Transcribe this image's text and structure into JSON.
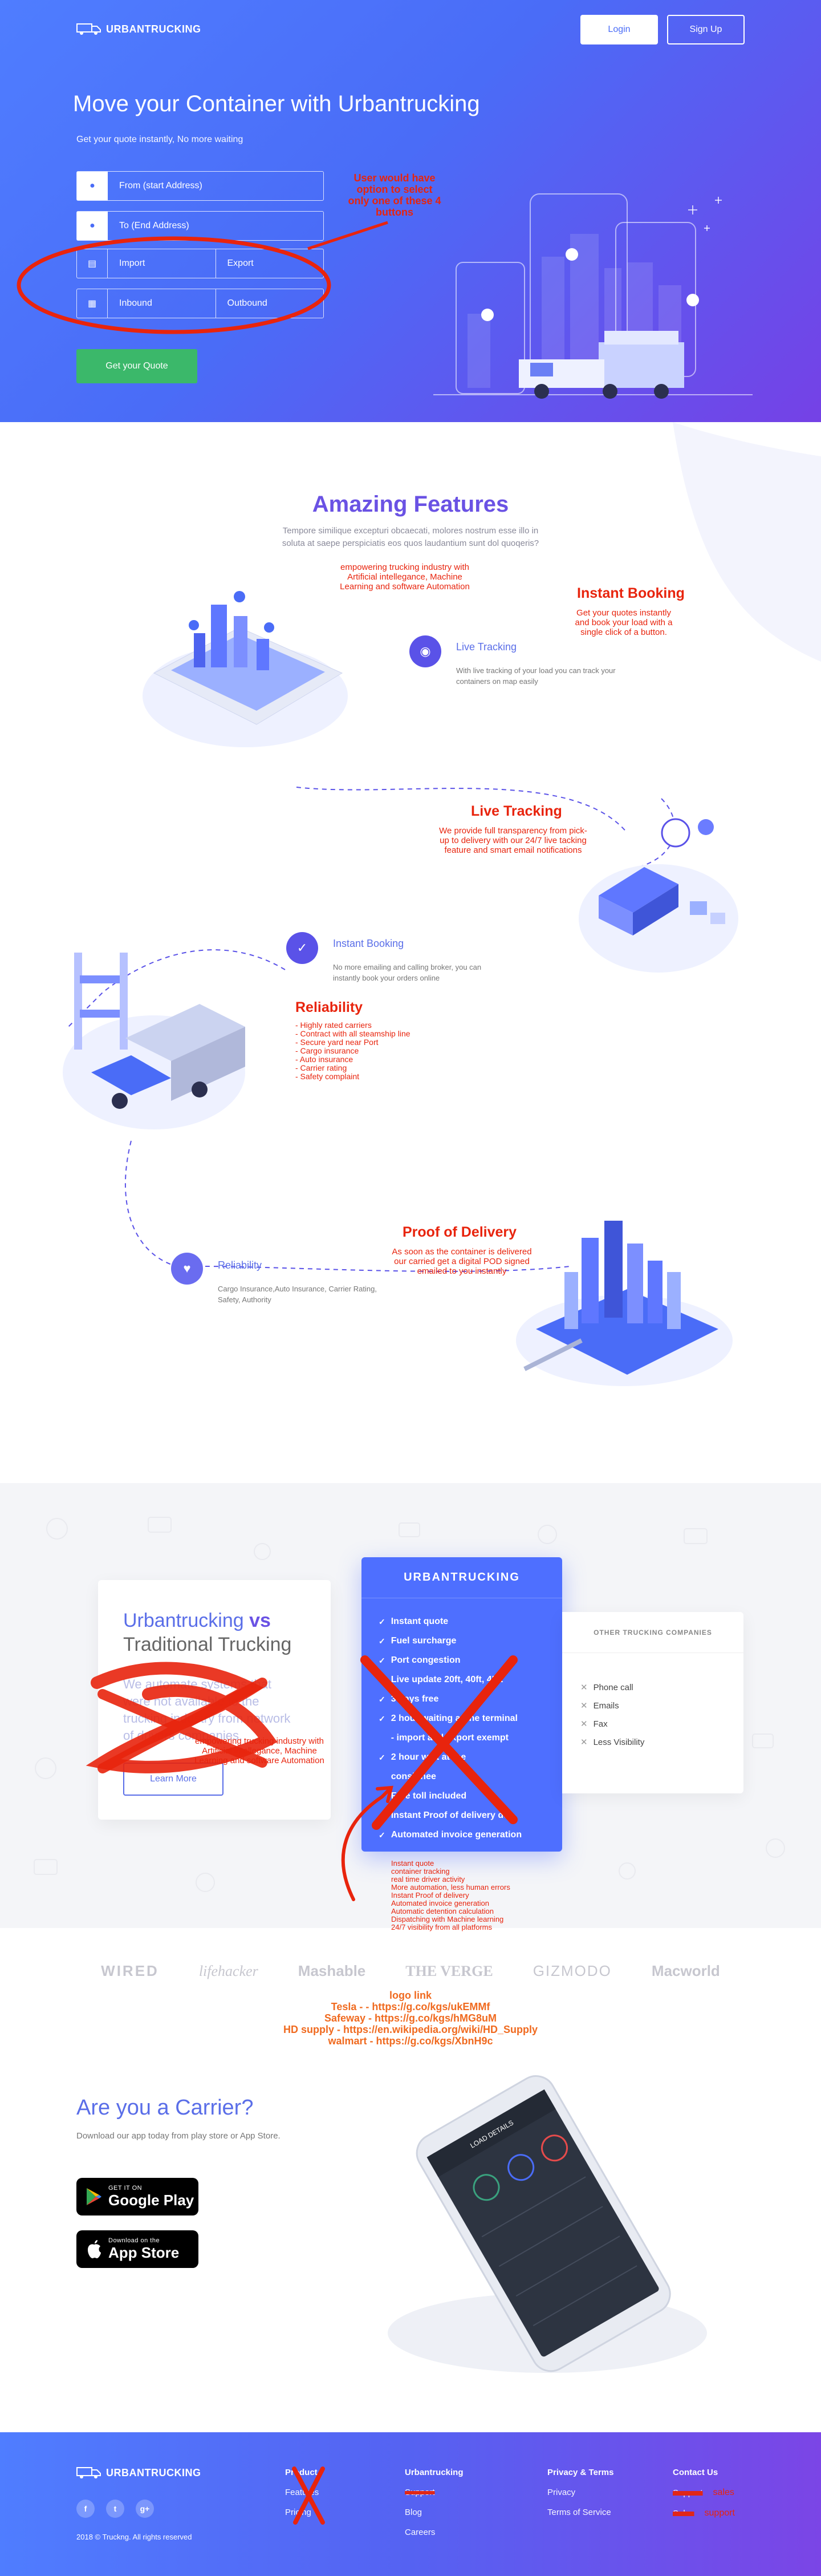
{
  "colors": {
    "brand_blue": "#4a6cf7",
    "brand_purple": "#7541e6",
    "green": "#3bb86a",
    "annotation_red": "#e8240d",
    "annotation_orange": "#f06a1f"
  },
  "header": {
    "logo_text": "URBANTRUCKING",
    "login": "Login",
    "signup": "Sign Up"
  },
  "hero": {
    "title": "Move your Container with Urbantrucking",
    "subtitle": "Get your quote instantly, No more waiting",
    "from_placeholder": "From (start Address)",
    "to_placeholder": "To (End Address)",
    "import": "Import",
    "export": "Export",
    "inbound": "Inbound",
    "outbound": "Outbound",
    "cta": "Get your Quote",
    "note": "User would have option to select only one of these 4 buttons"
  },
  "features": {
    "title": "Amazing Features",
    "subtitle": "Tempore similique excepturi obcaecati, molores nostrum esse illo in soluta at saepe perspiciatis eos quos laudantium sunt dol quoqeris?",
    "note_ai": "empowering trucking industry with Artificial intellegance, Machine Learning and software Automation",
    "instant_booking_note": {
      "title": "Instant Booking",
      "text": "Get your quotes instantly and book your load with a single click of a button."
    },
    "live_tracking": {
      "label": "Live Tracking",
      "desc": "With live tracking of your load you can track your containers on map easily"
    },
    "live_tracking_note": {
      "title": "Live Tracking",
      "text": "We provide full transparency from pick-up to delivery with our 24/7 live tacking feature and smart email notifications"
    },
    "instant_booking": {
      "label": "Instant Booking",
      "desc": "No more emailing and calling broker, you can instantly book your orders online"
    },
    "reliability_note": {
      "title": "Reliability",
      "items": [
        "- Highly rated carriers",
        "- Contract with all steamship line",
        "- Secure yard near Port",
        "- Cargo insurance",
        "- Auto insurance",
        "- Carrier rating",
        "- Safety complaint"
      ]
    },
    "reliability": {
      "label": "Reliability",
      "desc": "Cargo Insurance,Auto Insurance, Carrier Rating, Safety, Authority"
    },
    "pod_note": {
      "title": "Proof of Delivery",
      "text": "As soon as the container is delivered our carried get a digital POD signed emailed to you instantly"
    }
  },
  "compare": {
    "title_a": "Urbantrucking ",
    "title_vs": "vs",
    "title_b": "Traditional Trucking",
    "left_text": "We automate systems that were not available to the trucking industry from network of drivers companies.",
    "left_button": "Learn More",
    "mid_heading": "URBANTRUCKING",
    "mid_items": [
      "Instant quote",
      "Fuel surcharge",
      "Port congestion",
      "Live update 20ft, 40ft, 45ft",
      "3 days free",
      "2 hour waiting at the terminal",
      "- import and export exempt",
      "2 hour wait at the",
      "consignee",
      "Free toll included",
      "Instant Proof of delivery doc",
      "Automated invoice generation"
    ],
    "right_heading": "OTHER TRUCKING COMPANIES",
    "right_items": [
      "Phone call",
      "Emails",
      "Fax",
      "Less Visibility"
    ],
    "note_ai": "empowering trucking industry with Artificial intellegance, Machine Learning and software Automation",
    "note_list": [
      "Instant quote",
      "container tracking",
      "real time driver activity",
      "More automation, less human errors",
      "Instant Proof of delivery",
      "Automated invoice generation",
      "Automatic detention calculation",
      "Dispatching with Machine learning",
      "24/7 visibility from all platforms"
    ]
  },
  "press": {
    "logos": [
      "WIRED",
      "lifehacker",
      "Mashable",
      "THE VERGE",
      "GIZMODO",
      "Macworld"
    ],
    "note_title": "logo link",
    "note_lines": [
      "Tesla  -  - https://g.co/kgs/ukEMMf",
      "Safeway - https://g.co/kgs/hMG8uM",
      "HD supply - https://en.wikipedia.org/wiki/HD_Supply",
      "walmart - https://g.co/kgs/XbnH9c"
    ]
  },
  "carrier": {
    "title": "Are you a Carrier?",
    "subtitle": "Download our app today from play store or App Store.",
    "google_small": "GET IT ON",
    "google_big": "Google Play",
    "apple_small": "Download on the",
    "apple_big": "App Store",
    "phone_header": "LOAD DETAILS"
  },
  "footer": {
    "logo_text": "URBANTRUCKING",
    "copyright": "2018 © Truckng. All rights reserved",
    "col1": {
      "heading": "Product",
      "links": [
        "Features",
        "Pricing"
      ]
    },
    "col2": {
      "heading": "Urbantrucking",
      "links": [
        "Support",
        "Blog",
        "Careers"
      ]
    },
    "col3": {
      "heading": "Privacy & Terms",
      "links": [
        "Privacy",
        "Terms of Service"
      ]
    },
    "col4": {
      "heading": "Contact Us",
      "links": [
        "Support",
        "Sales"
      ]
    },
    "sales_note": "sales",
    "support_note": "support"
  }
}
